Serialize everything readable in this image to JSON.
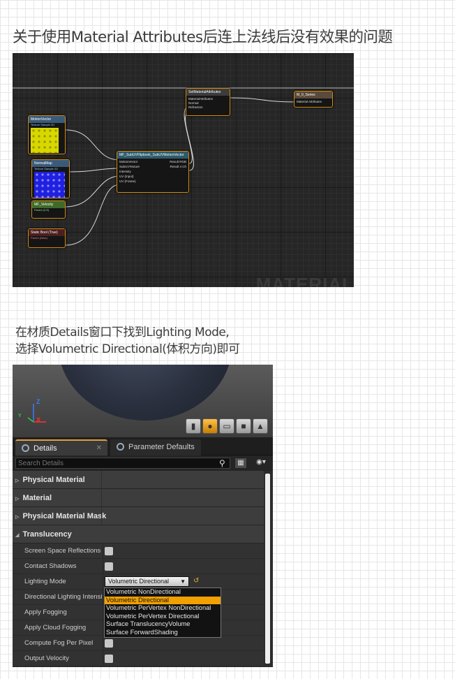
{
  "title": "关于使用Material Attributes后连上法线后没有效果的问题",
  "note": {
    "line1": "在材质Details窗口下找到Lighting Mode,",
    "line2": "选择Volumetric Directional(体积方向)即可"
  },
  "graph": {
    "watermark": "MATERIAL",
    "nodes": {
      "set_attrs": {
        "title": "SetMaterialAttributes",
        "pins": [
          "MaterialAttributes",
          "Normal",
          "Refraction"
        ]
      },
      "m_series": {
        "title": "M_0_Series",
        "pins": [
          "Material Attributes"
        ]
      },
      "motion_vector": {
        "title": "MotionVector",
        "sub": "Texture Sample 2D"
      },
      "normal_map": {
        "title": "NormalMap",
        "sub": "Texture Sample 2D"
      },
      "velocity": {
        "title": "MF_Velocity",
        "sub": "Param (0.5)"
      },
      "static_bool": {
        "title": "Static Bool (True)",
        "sub": "Param (false)"
      },
      "flipbook": {
        "title": "MF_SubUVFlipbook_SubUVMotionVector",
        "in_pins": [
          "MotionVector",
          "SubUVTexture",
          "Intensity",
          "UV (Input)",
          "UV (Frame)"
        ],
        "out_pins": [
          "Result RGB",
          "Result 4 Ch"
        ]
      }
    }
  },
  "viewport": {
    "axis_z": "Z",
    "axis_x": "X",
    "axis_y": "Y",
    "buttons": [
      "cylinder-icon",
      "sphere-icon",
      "plane-icon",
      "cube-icon",
      "teapot-icon"
    ]
  },
  "tabs": [
    {
      "label": "Details"
    },
    {
      "label": "Parameter Defaults"
    }
  ],
  "search": {
    "placeholder": "Search Details"
  },
  "categories": {
    "physical_material": "Physical Material",
    "material": "Material",
    "physical_material_mask": "Physical Material Mask",
    "translucency": "Translucency"
  },
  "properties": {
    "screen_space_reflections": "Screen Space Reflections",
    "contact_shadows": "Contact Shadows",
    "lighting_mode": "Lighting Mode",
    "directional_lighting_intensity": "Directional Lighting Intensity",
    "apply_fogging": "Apply Fogging",
    "apply_cloud_fogging": "Apply Cloud Fogging",
    "compute_fog_per_pixel": "Compute Fog Per Pixel",
    "output_velocity": "Output Velocity"
  },
  "lighting_mode_value": "Volumetric Directional",
  "lighting_mode_options": [
    "Volumetric NonDirectional",
    "Volumetric Directional",
    "Volumetric PerVertex NonDirectional",
    "Volumetric PerVertex Directional",
    "Surface TranslucencyVolume",
    "Surface ForwardShading"
  ],
  "colors": {
    "accent": "#f0a000",
    "node_border": "#d08a10",
    "graph_bg": "#262626"
  }
}
